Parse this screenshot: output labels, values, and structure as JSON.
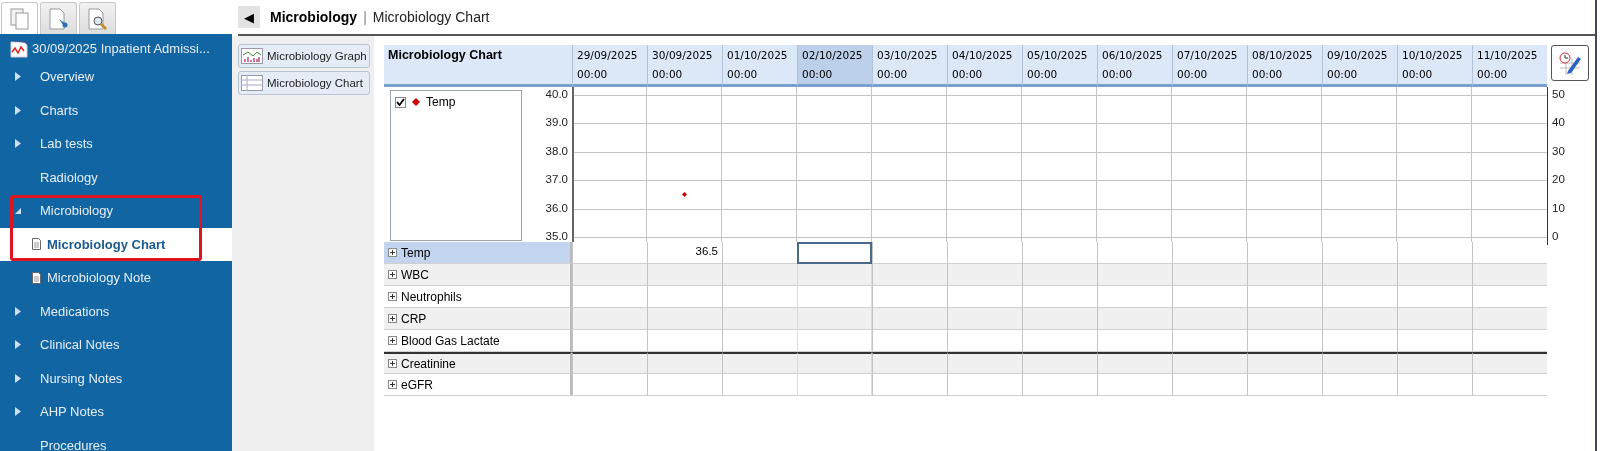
{
  "nav_tabs": [
    {
      "kind": "documents",
      "selected": true
    },
    {
      "kind": "pin",
      "selected": false
    },
    {
      "kind": "search",
      "selected": false
    }
  ],
  "sidebar": {
    "header": "30/09/2025 Inpatient Admissi...",
    "items": [
      {
        "label": "Overview",
        "expandable": true,
        "expanded": false
      },
      {
        "label": "Charts",
        "expandable": true,
        "expanded": false
      },
      {
        "label": "Lab tests",
        "expandable": true,
        "expanded": false
      },
      {
        "label": "Radiology",
        "expandable": false
      },
      {
        "label": "Microbiology",
        "expandable": true,
        "expanded": true,
        "highlighted": true,
        "children": [
          {
            "label": "Microbiology Chart",
            "selected": true
          },
          {
            "label": "Microbiology Note",
            "selected": false
          }
        ]
      },
      {
        "label": "Medications",
        "expandable": true,
        "expanded": false
      },
      {
        "label": "Clinical Notes",
        "expandable": true,
        "expanded": false
      },
      {
        "label": "Nursing Notes",
        "expandable": true,
        "expanded": false
      },
      {
        "label": "AHP Notes",
        "expandable": true,
        "expanded": false
      },
      {
        "label": "Procedures",
        "expandable": false
      }
    ]
  },
  "page": {
    "back_button": "◀",
    "title": "Microbiology",
    "separator": "|",
    "subtitle": "Microbiology Chart"
  },
  "view_buttons": [
    {
      "label": "Microbiology Graph",
      "kind": "graph"
    },
    {
      "label": "Microbiology Chart",
      "kind": "table"
    }
  ],
  "grid": {
    "title": "Microbiology Chart",
    "columns": [
      {
        "date": "29/09/2025",
        "time": "00:00",
        "selected": false
      },
      {
        "date": "30/09/2025",
        "time": "00:00",
        "selected": false
      },
      {
        "date": "01/10/2025",
        "time": "00:00",
        "selected": false
      },
      {
        "date": "02/10/2025",
        "time": "00:00",
        "selected": true
      },
      {
        "date": "03/10/2025",
        "time": "00:00",
        "selected": false
      },
      {
        "date": "04/10/2025",
        "time": "00:00",
        "selected": false
      },
      {
        "date": "05/10/2025",
        "time": "00:00",
        "selected": false
      },
      {
        "date": "06/10/2025",
        "time": "00:00",
        "selected": false
      },
      {
        "date": "07/10/2025",
        "time": "00:00",
        "selected": false
      },
      {
        "date": "08/10/2025",
        "time": "00:00",
        "selected": false
      },
      {
        "date": "09/10/2025",
        "time": "00:00",
        "selected": false
      },
      {
        "date": "10/10/2025",
        "time": "00:00",
        "selected": false
      },
      {
        "date": "11/10/2025",
        "time": "00:00",
        "selected": false
      }
    ],
    "legend": [
      {
        "checked": true
      }
    ],
    "chart_data": {
      "type": "scatter",
      "grid": true,
      "ylim": [
        35,
        40
      ],
      "yticks": [
        {
          "value": 40,
          "label": "40.0"
        },
        {
          "value": 39,
          "label": "39.0"
        },
        {
          "value": 38,
          "label": "38.0"
        },
        {
          "value": 37,
          "label": "37.0"
        },
        {
          "value": 36,
          "label": "36.0"
        },
        {
          "value": 35,
          "label": "35.0"
        }
      ],
      "series": [
        {
          "name": "Temp",
          "color": "#cc0000",
          "values": [
            null,
            36.5,
            null,
            null,
            null,
            null,
            null,
            null,
            null,
            null,
            null,
            null,
            null
          ]
        }
      ]
    },
    "right_axis": [
      "50",
      "40",
      "30",
      "20",
      "10",
      "0"
    ],
    "rows": [
      {
        "label": "Temp",
        "selected": true,
        "group_start": false,
        "cells": [
          {},
          {
            "text": "36.5"
          },
          {},
          {},
          {},
          {},
          {},
          {},
          {},
          {},
          {},
          {},
          {}
        ]
      },
      {
        "label": "WBC",
        "selected": false,
        "group_start": false
      },
      {
        "label": "Neutrophils",
        "selected": false,
        "group_start": false
      },
      {
        "label": "CRP",
        "selected": false,
        "group_start": false
      },
      {
        "label": "Blood Gas Lactate",
        "selected": false,
        "group_start": false
      },
      {
        "label": "Creatinine",
        "selected": false,
        "group_start": true
      },
      {
        "label": "eGFR",
        "selected": false,
        "group_start": false
      }
    ]
  }
}
